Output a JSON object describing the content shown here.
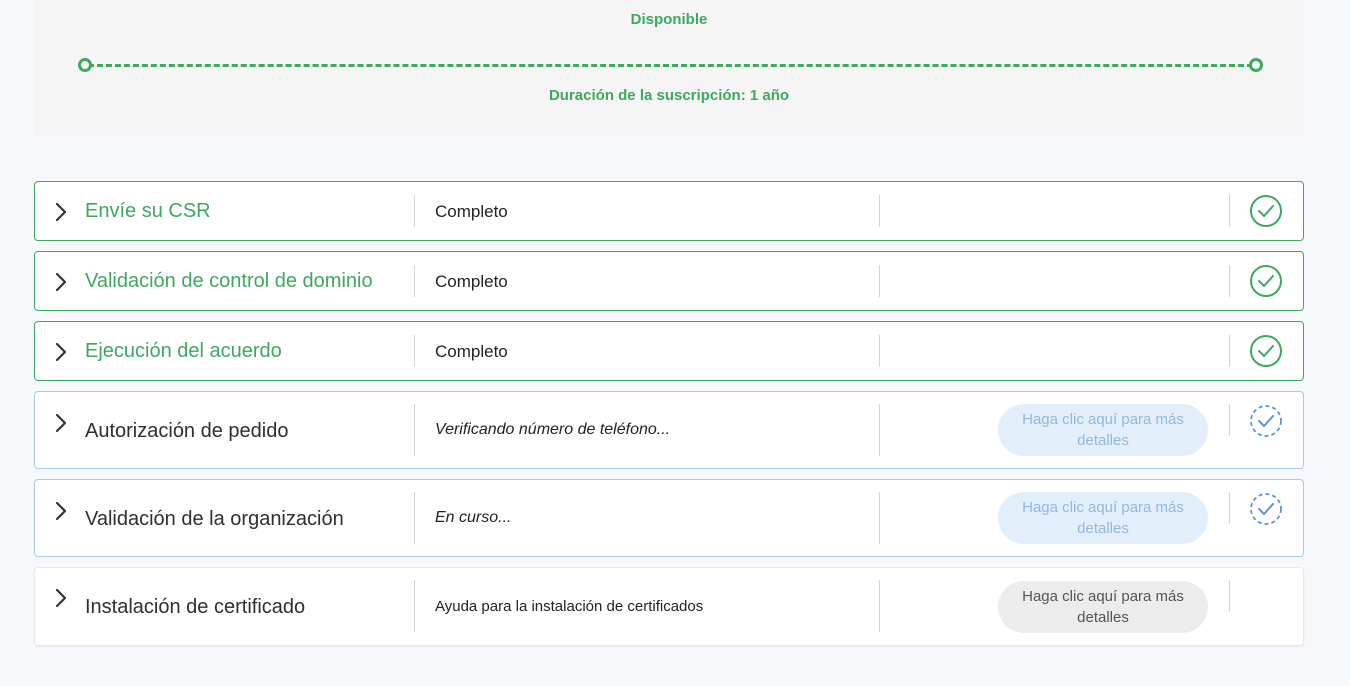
{
  "subscription": {
    "status": "Disponible",
    "duration": "Duración de la suscripción: 1 año",
    "accent_color": "#3ea860"
  },
  "steps": [
    {
      "title": "Envíe su CSR",
      "status": "Completo",
      "state": "complete",
      "icon": "check-circle-icon"
    },
    {
      "title": "Validación de control de dominio",
      "status": "Completo",
      "state": "complete",
      "icon": "check-circle-icon"
    },
    {
      "title": "Ejecución del acuerdo",
      "status": "Completo",
      "state": "complete",
      "icon": "check-circle-icon"
    },
    {
      "title": "Autorización de pedido",
      "status": "Verificando número de teléfono...",
      "state": "in-progress",
      "button": "Haga clic aquí para más detalles",
      "icon": "pending-check-icon"
    },
    {
      "title": "Validación de la organización",
      "status": "En curso...",
      "state": "in-progress",
      "button": "Haga clic aquí para más detalles",
      "icon": "pending-check-icon"
    },
    {
      "title": "Instalación de certificado",
      "status": "Ayuda para la instalación de certificados",
      "state": "help",
      "button": "Haga clic aquí para más detalles"
    }
  ],
  "colors": {
    "complete": "#3ea860",
    "pending": "#93b8e0",
    "pending_button_bg": "#e3eefb",
    "neutral_button_bg": "#ececec"
  }
}
